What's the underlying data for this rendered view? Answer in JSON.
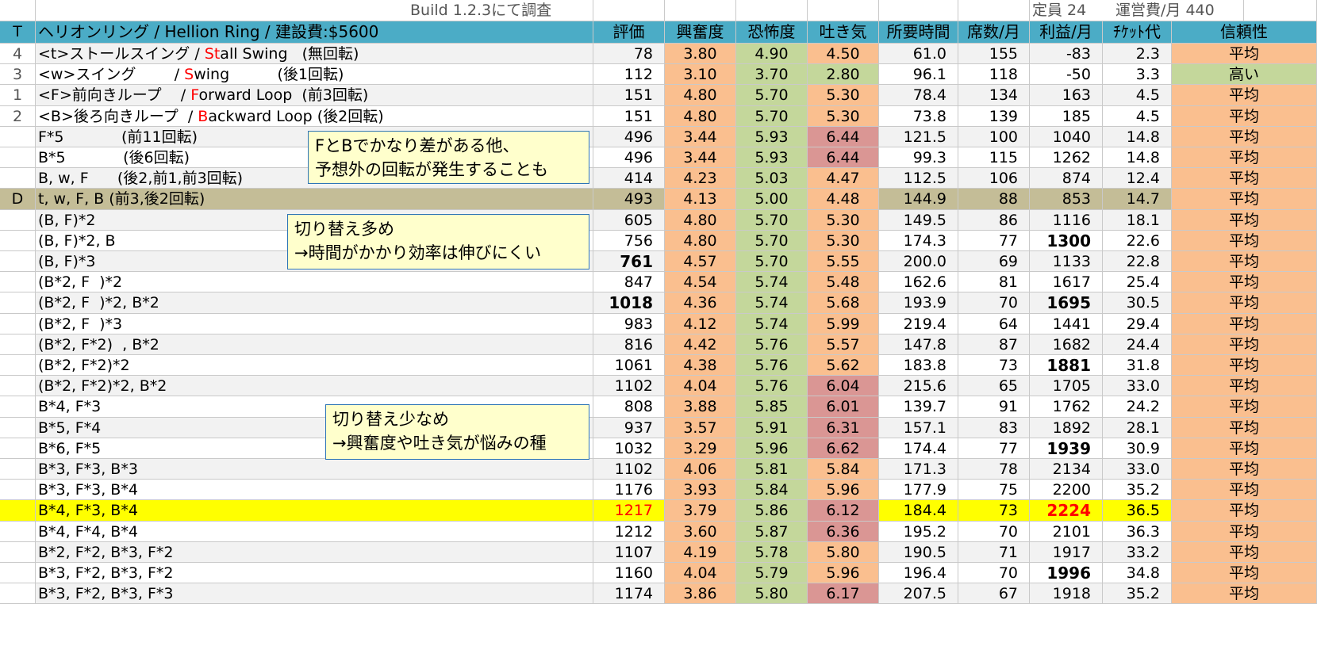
{
  "top": {
    "a": "",
    "b": "",
    "build": "Build 1.2.3にて調査",
    "capacity": "定員 24",
    "upkeep": "運営費/月 440"
  },
  "header": {
    "t": "T",
    "ride": "ヘリオンリング / Hellion Ring / 建設費:$5600",
    "cols": [
      "評価",
      "興奮度",
      "恐怖度",
      "吐き気",
      "所要時間",
      "席数/月",
      "利益/月",
      "ﾁｹｯﾄ代",
      "信頼性"
    ]
  },
  "rows": [
    {
      "t": "4",
      "name_pre": "<t>ストールスイング / ",
      "name_red": "St",
      "name_post": "all Swing   (無回転)",
      "vals": [
        "78",
        "3.80",
        "4.90",
        "4.50",
        "61.0",
        "155",
        "-83",
        "2.3",
        "平均"
      ],
      "fill": [
        "",
        "or",
        "gr",
        "or",
        "",
        "",
        "",
        "",
        "or"
      ]
    },
    {
      "t": "3",
      "name_pre": "<w>スイング        / ",
      "name_red": "S",
      "name_post": "wing          (後1回転)",
      "vals": [
        "112",
        "3.10",
        "3.70",
        "2.80",
        "96.1",
        "118",
        "-50",
        "3.3",
        "高い"
      ],
      "fill": [
        "",
        "or",
        "gr",
        "gr",
        "",
        "",
        "",
        "",
        "gr"
      ]
    },
    {
      "t": "1",
      "name_pre": "<F>前向きループ    / ",
      "name_red": "F",
      "name_post": "orward Loop  (前3回転)",
      "vals": [
        "151",
        "4.80",
        "5.70",
        "5.30",
        "78.4",
        "134",
        "163",
        "4.5",
        "平均"
      ],
      "fill": [
        "",
        "or",
        "gr",
        "or",
        "",
        "",
        "",
        "",
        "or"
      ]
    },
    {
      "t": "2",
      "name_pre": "<B>後ろ向きループ  / ",
      "name_red": "B",
      "name_post": "ackward Loop (後2回転)",
      "vals": [
        "151",
        "4.80",
        "5.70",
        "5.30",
        "73.8",
        "139",
        "185",
        "4.5",
        "平均"
      ],
      "fill": [
        "",
        "or",
        "gr",
        "or",
        "",
        "",
        "",
        "",
        "or"
      ]
    },
    {
      "t": "",
      "name_pre": "F*5            (前11回転)",
      "name_red": "",
      "name_post": "",
      "vals": [
        "496",
        "3.44",
        "5.93",
        "6.44",
        "121.5",
        "100",
        "1040",
        "14.8",
        "平均"
      ],
      "fill": [
        "",
        "or",
        "gr",
        "rd",
        "",
        "",
        "",
        "",
        "or"
      ]
    },
    {
      "t": "",
      "name_pre": "B*5            (後6回転)",
      "name_red": "",
      "name_post": "",
      "vals": [
        "496",
        "3.44",
        "5.93",
        "6.44",
        "99.3",
        "115",
        "1262",
        "14.8",
        "平均"
      ],
      "fill": [
        "",
        "or",
        "gr",
        "rd",
        "",
        "",
        "",
        "",
        "or"
      ]
    },
    {
      "t": "",
      "name_pre": "B, w, F      (後2,前1,前3回転)",
      "name_red": "",
      "name_post": "",
      "vals": [
        "414",
        "4.23",
        "5.03",
        "4.47",
        "112.5",
        "106",
        "874",
        "12.4",
        "平均"
      ],
      "fill": [
        "",
        "or",
        "gr",
        "or",
        "",
        "",
        "",
        "",
        "or"
      ]
    },
    {
      "t": "D",
      "name_pre": "t, w, F, B (前3,後2回転)",
      "name_red": "",
      "name_post": "",
      "vals": [
        "493",
        "4.13",
        "5.00",
        "4.48",
        "144.9",
        "88",
        "853",
        "14.7",
        "平均"
      ],
      "fill": [
        "",
        "or",
        "gr",
        "or",
        "",
        "",
        "",
        "",
        "or"
      ],
      "row": "tan"
    },
    {
      "t": "",
      "name_pre": "(B, F)*2",
      "name_red": "",
      "name_post": "",
      "vals": [
        "605",
        "4.80",
        "5.70",
        "5.30",
        "149.5",
        "86",
        "1116",
        "18.1",
        "平均"
      ],
      "fill": [
        "",
        "or",
        "gr",
        "or",
        "",
        "",
        "",
        "",
        "or"
      ]
    },
    {
      "t": "",
      "name_pre": "(B, F)*2, B",
      "name_red": "",
      "name_post": "",
      "vals": [
        "756",
        "4.80",
        "5.70",
        "5.30",
        "174.3",
        "77",
        "1300",
        "22.6",
        "平均"
      ],
      "fill": [
        "",
        "or",
        "gr",
        "or",
        "",
        "",
        "",
        "",
        "or"
      ],
      "bold": [
        6
      ]
    },
    {
      "t": "",
      "name_pre": "(B, F)*3",
      "name_red": "",
      "name_post": "",
      "vals": [
        "761",
        "4.57",
        "5.70",
        "5.55",
        "200.0",
        "69",
        "1133",
        "22.8",
        "平均"
      ],
      "fill": [
        "",
        "or",
        "gr",
        "or",
        "",
        "",
        "",
        "",
        "or"
      ],
      "bold": [
        0
      ]
    },
    {
      "t": "",
      "name_pre": "(B*2, F  )*2",
      "name_red": "",
      "name_post": "",
      "vals": [
        "847",
        "4.54",
        "5.74",
        "5.48",
        "162.6",
        "81",
        "1617",
        "25.4",
        "平均"
      ],
      "fill": [
        "",
        "or",
        "gr",
        "or",
        "",
        "",
        "",
        "",
        "or"
      ]
    },
    {
      "t": "",
      "name_pre": "(B*2, F  )*2, B*2",
      "name_red": "",
      "name_post": "",
      "vals": [
        "1018",
        "4.36",
        "5.74",
        "5.68",
        "193.9",
        "70",
        "1695",
        "30.5",
        "平均"
      ],
      "fill": [
        "",
        "or",
        "gr",
        "or",
        "",
        "",
        "",
        "",
        "or"
      ],
      "bold": [
        0,
        6
      ]
    },
    {
      "t": "",
      "name_pre": "(B*2, F  )*3",
      "name_red": "",
      "name_post": "",
      "vals": [
        "983",
        "4.12",
        "5.74",
        "5.99",
        "219.4",
        "64",
        "1441",
        "29.4",
        "平均"
      ],
      "fill": [
        "",
        "or",
        "gr",
        "or",
        "",
        "",
        "",
        "",
        "or"
      ]
    },
    {
      "t": "",
      "name_pre": "(B*2, F*2)  , B*2",
      "name_red": "",
      "name_post": "",
      "vals": [
        "816",
        "4.42",
        "5.76",
        "5.57",
        "147.8",
        "87",
        "1682",
        "24.4",
        "平均"
      ],
      "fill": [
        "",
        "or",
        "gr",
        "or",
        "",
        "",
        "",
        "",
        "or"
      ]
    },
    {
      "t": "",
      "name_pre": "(B*2, F*2)*2",
      "name_red": "",
      "name_post": "",
      "vals": [
        "1061",
        "4.38",
        "5.76",
        "5.62",
        "183.8",
        "73",
        "1881",
        "31.8",
        "平均"
      ],
      "fill": [
        "",
        "or",
        "gr",
        "or",
        "",
        "",
        "",
        "",
        "or"
      ],
      "bold": [
        6
      ]
    },
    {
      "t": "",
      "name_pre": "(B*2, F*2)*2, B*2",
      "name_red": "",
      "name_post": "",
      "vals": [
        "1102",
        "4.04",
        "5.76",
        "6.04",
        "215.6",
        "65",
        "1705",
        "33.0",
        "平均"
      ],
      "fill": [
        "",
        "or",
        "gr",
        "rd",
        "",
        "",
        "",
        "",
        "or"
      ]
    },
    {
      "t": "",
      "name_pre": "B*4, F*3",
      "name_red": "",
      "name_post": "",
      "vals": [
        "808",
        "3.88",
        "5.85",
        "6.01",
        "139.7",
        "91",
        "1762",
        "24.2",
        "平均"
      ],
      "fill": [
        "",
        "or",
        "gr",
        "rd",
        "",
        "",
        "",
        "",
        "or"
      ]
    },
    {
      "t": "",
      "name_pre": "B*5, F*4",
      "name_red": "",
      "name_post": "",
      "vals": [
        "937",
        "3.57",
        "5.91",
        "6.31",
        "157.1",
        "83",
        "1892",
        "28.1",
        "平均"
      ],
      "fill": [
        "",
        "or",
        "gr",
        "rd",
        "",
        "",
        "",
        "",
        "or"
      ]
    },
    {
      "t": "",
      "name_pre": "B*6, F*5",
      "name_red": "",
      "name_post": "",
      "vals": [
        "1032",
        "3.29",
        "5.96",
        "6.62",
        "174.4",
        "77",
        "1939",
        "30.9",
        "平均"
      ],
      "fill": [
        "",
        "or",
        "gr",
        "rd",
        "",
        "",
        "",
        "",
        "or"
      ],
      "bold": [
        6
      ]
    },
    {
      "t": "",
      "name_pre": "B*3, F*3, B*3",
      "name_red": "",
      "name_post": "",
      "vals": [
        "1102",
        "4.06",
        "5.81",
        "5.84",
        "171.3",
        "78",
        "2134",
        "33.0",
        "平均"
      ],
      "fill": [
        "",
        "or",
        "gr",
        "or",
        "",
        "",
        "",
        "",
        "or"
      ]
    },
    {
      "t": "",
      "name_pre": "B*3, F*3, B*4",
      "name_red": "",
      "name_post": "",
      "vals": [
        "1176",
        "3.93",
        "5.84",
        "5.96",
        "177.9",
        "75",
        "2200",
        "35.2",
        "平均"
      ],
      "fill": [
        "",
        "or",
        "gr",
        "or",
        "",
        "",
        "",
        "",
        "or"
      ]
    },
    {
      "t": "",
      "name_pre": "B*4, F*3, B*4",
      "name_red": "",
      "name_post": "",
      "vals": [
        "1217",
        "3.79",
        "5.86",
        "6.12",
        "184.4",
        "73",
        "2224",
        "36.5",
        "平均"
      ],
      "fill": [
        "",
        "or",
        "gr",
        "rd",
        "",
        "",
        "",
        "",
        "or"
      ],
      "row": "yellow",
      "bold": [
        6
      ],
      "redtext": [
        0,
        6
      ]
    },
    {
      "t": "",
      "name_pre": "B*4, F*4, B*4",
      "name_red": "",
      "name_post": "",
      "vals": [
        "1212",
        "3.60",
        "5.87",
        "6.36",
        "195.2",
        "70",
        "2101",
        "36.3",
        "平均"
      ],
      "fill": [
        "",
        "or",
        "gr",
        "rd",
        "",
        "",
        "",
        "",
        "or"
      ]
    },
    {
      "t": "",
      "name_pre": "B*2, F*2, B*3, F*2",
      "name_red": "",
      "name_post": "",
      "vals": [
        "1107",
        "4.19",
        "5.78",
        "5.80",
        "190.5",
        "71",
        "1917",
        "33.2",
        "平均"
      ],
      "fill": [
        "",
        "or",
        "gr",
        "or",
        "",
        "",
        "",
        "",
        "or"
      ]
    },
    {
      "t": "",
      "name_pre": "B*3, F*2, B*3, F*2",
      "name_red": "",
      "name_post": "",
      "vals": [
        "1160",
        "4.04",
        "5.79",
        "5.96",
        "196.4",
        "70",
        "1996",
        "34.8",
        "平均"
      ],
      "fill": [
        "",
        "or",
        "gr",
        "or",
        "",
        "",
        "",
        "",
        "or"
      ],
      "bold": [
        6
      ]
    },
    {
      "t": "",
      "name_pre": "B*3, F*2, B*3, F*3",
      "name_red": "",
      "name_post": "",
      "vals": [
        "1174",
        "3.86",
        "5.80",
        "6.17",
        "207.5",
        "67",
        "1918",
        "35.2",
        "平均"
      ],
      "fill": [
        "",
        "or",
        "gr",
        "rd",
        "",
        "",
        "",
        "",
        "or"
      ]
    }
  ],
  "notes": [
    {
      "lines": [
        "FとBでかなり差がある他、",
        "予想外の回転が発生することも"
      ]
    },
    {
      "lines": [
        "切り替え多め",
        "→時間がかかり効率は伸びにくい"
      ]
    },
    {
      "lines": [
        "切り替え少なめ",
        "→興奮度や吐き気が悩みの種"
      ]
    }
  ],
  "colors": {
    "header": "#4bacc6",
    "orange": "#fabf8f",
    "green": "#c4d79b",
    "red": "#da9694",
    "tan": "#c4bd97",
    "yellow": "#ffff00",
    "zebra": "#f2f2f2",
    "note_border": "#2e75b6"
  }
}
